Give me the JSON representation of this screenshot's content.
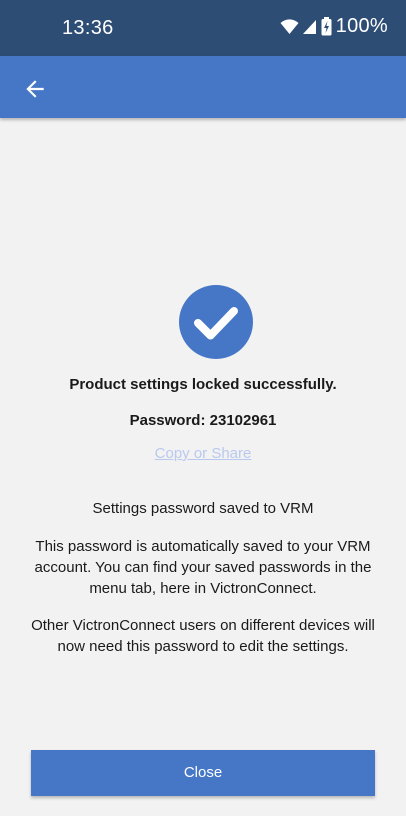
{
  "status_bar": {
    "time": "13:36",
    "battery_percent": "100%",
    "icons": [
      "wifi-icon",
      "signal-icon",
      "battery-icon"
    ],
    "background_color": "#2d4d75"
  },
  "app_bar": {
    "back_icon": "arrow-left-icon",
    "background_color": "#4677c7"
  },
  "main": {
    "success_icon": "check-circle-icon",
    "success_title": "Product settings locked successfully.",
    "password_label": "Password: 23102961",
    "copy_share_link": "Copy or Share",
    "saved_heading": "Settings password saved to VRM",
    "info_paragraph_1": "This password is automatically saved to your VRM account. You can find your saved passwords in the menu tab, here in VictronConnect.",
    "info_paragraph_2": "Other VictronConnect users on different devices will now need this password to edit the settings."
  },
  "footer": {
    "close_button_label": "Close"
  },
  "colors": {
    "accent": "#4677c7",
    "link_disabled": "#b9c9ee",
    "background": "#f2f2f2"
  }
}
